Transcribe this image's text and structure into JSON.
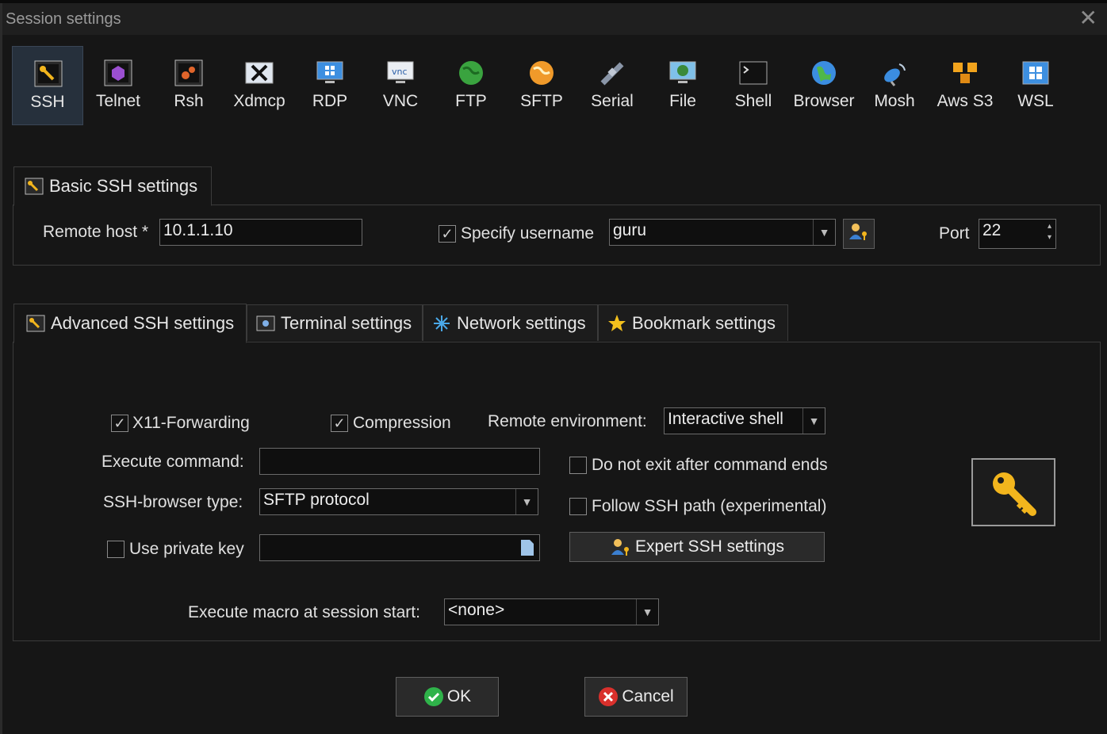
{
  "window": {
    "title": "Session settings",
    "close_glyph": "✕"
  },
  "session_types": [
    {
      "label": "SSH",
      "icon": "key-wrench-icon",
      "active": true
    },
    {
      "label": "Telnet",
      "icon": "telnet-icon"
    },
    {
      "label": "Rsh",
      "icon": "rsh-icon"
    },
    {
      "label": "Xdmcp",
      "icon": "x-window-icon"
    },
    {
      "label": "RDP",
      "icon": "rdp-monitor-icon"
    },
    {
      "label": "VNC",
      "icon": "vnc-icon"
    },
    {
      "label": "FTP",
      "icon": "globe-green-icon"
    },
    {
      "label": "SFTP",
      "icon": "globe-orange-icon"
    },
    {
      "label": "Serial",
      "icon": "satellite-icon"
    },
    {
      "label": "File",
      "icon": "monitor-file-icon"
    },
    {
      "label": "Shell",
      "icon": "terminal-icon"
    },
    {
      "label": "Browser",
      "icon": "globe-browser-icon"
    },
    {
      "label": "Mosh",
      "icon": "dish-icon"
    },
    {
      "label": "Aws S3",
      "icon": "cubes-icon"
    },
    {
      "label": "WSL",
      "icon": "windows-icon"
    }
  ],
  "basic": {
    "tab_label": "Basic SSH settings",
    "remote_host_label": "Remote host *",
    "remote_host_value": "10.1.1.10",
    "specify_username_label": "Specify username",
    "specify_username_checked": true,
    "username_value": "guru",
    "port_label": "Port",
    "port_value": "22"
  },
  "advanced_tabs": [
    {
      "label": "Advanced SSH settings",
      "icon": "wrench-icon",
      "active": true
    },
    {
      "label": "Terminal settings",
      "icon": "terminal-settings-icon"
    },
    {
      "label": "Network settings",
      "icon": "network-icon"
    },
    {
      "label": "Bookmark settings",
      "icon": "star-icon"
    }
  ],
  "advanced": {
    "x11_label": "X11-Forwarding",
    "x11_checked": true,
    "compression_label": "Compression",
    "compression_checked": true,
    "remote_env_label": "Remote environment:",
    "remote_env_value": "Interactive shell",
    "execute_command_label": "Execute command:",
    "execute_command_value": "",
    "do_not_exit_label": "Do not exit after command ends",
    "do_not_exit_checked": false,
    "browser_type_label": "SSH-browser type:",
    "browser_type_value": "SFTP protocol",
    "follow_path_label": "Follow SSH path (experimental)",
    "follow_path_checked": false,
    "private_key_label": "Use private key",
    "private_key_checked": false,
    "private_key_value": "",
    "expert_button_label": "Expert SSH settings",
    "macro_label": "Execute macro at session start:",
    "macro_value": "<none>"
  },
  "footer": {
    "ok_label": "OK",
    "cancel_label": "Cancel"
  },
  "colors": {
    "background": "#161616",
    "active_tab": "#26303c",
    "ok_green": "#2fb34a",
    "cancel_red": "#d9302c",
    "key_gold": "#f2b51d"
  }
}
